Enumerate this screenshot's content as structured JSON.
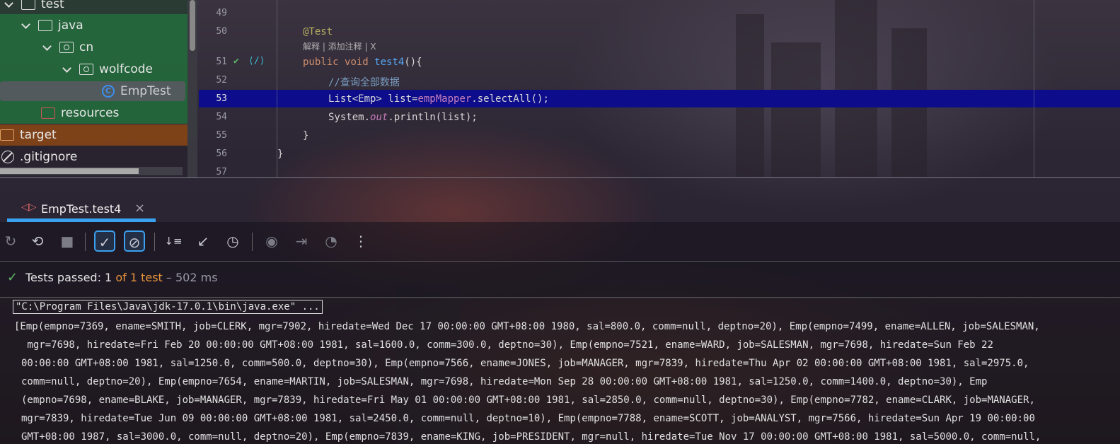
{
  "tree": {
    "items": [
      {
        "label": "test",
        "kind": "folder"
      },
      {
        "label": "java",
        "kind": "folder"
      },
      {
        "label": "cn",
        "kind": "package"
      },
      {
        "label": "wolfcode",
        "kind": "package"
      },
      {
        "label": "EmpTest",
        "kind": "class"
      },
      {
        "label": "resources",
        "kind": "resources-folder"
      },
      {
        "label": "target",
        "kind": "folder"
      },
      {
        "label": ".gitignore",
        "kind": "file"
      }
    ]
  },
  "editor": {
    "line_numbers": [
      "49",
      "50",
      "51",
      "52",
      "53",
      "54",
      "55",
      "56",
      "57"
    ],
    "annotation": "@Test",
    "inlay_hint": "解释 | 添加注释 | X",
    "method_keyword1": "public",
    "method_keyword2": "void",
    "method_name": "test4",
    "method_tail": "(){",
    "comment": "//查询全部数据",
    "stmt1_a": "List<Emp> list=",
    "stmt1_field": "empMapper",
    "stmt1_b": ".selectAll();",
    "stmt2_a": "System.",
    "stmt2_out": "out",
    "stmt2_b": ".println(list);",
    "close_method": "}",
    "close_class": "}",
    "highlight_line": "53"
  },
  "run": {
    "tab_label": "EmpTest.test4",
    "close_glyph": "×",
    "toolbar": {
      "rerun": "↻",
      "rerun_failed": "⟲",
      "stop": "■",
      "show_passed": "✓",
      "show_ignored": "⊘",
      "sort": "↓≡",
      "collapse": "↙",
      "history": "◷",
      "screenshot": "◉",
      "import": "⇥",
      "profile": "◔",
      "more": "⋮"
    },
    "status": {
      "check": "✓",
      "prefix": "Tests passed: ",
      "passed": "1",
      "of_text": "of 1 test",
      "duration": " – 502 ms"
    }
  },
  "console": {
    "command": "\"C:\\Program Files\\Java\\jdk-17.0.1\\bin\\java.exe\" ...",
    "lines": [
      "[Emp(empno=7369, ename=SMITH, job=CLERK, mgr=7902, hiredate=Wed Dec 17 00:00:00 GMT+08:00 1980, sal=800.0, comm=null, deptno=20), Emp(empno=7499, ename=ALLEN, job=SALESMAN,",
      " mgr=7698, hiredate=Fri Feb 20 00:00:00 GMT+08:00 1981, sal=1600.0, comm=300.0, deptno=30), Emp(empno=7521, ename=WARD, job=SALESMAN, mgr=7698, hiredate=Sun Feb 22",
      "00:00:00 GMT+08:00 1981, sal=1250.0, comm=500.0, deptno=30), Emp(empno=7566, ename=JONES, job=MANAGER, mgr=7839, hiredate=Thu Apr 02 00:00:00 GMT+08:00 1981, sal=2975.0,",
      "comm=null, deptno=20), Emp(empno=7654, ename=MARTIN, job=SALESMAN, mgr=7698, hiredate=Mon Sep 28 00:00:00 GMT+08:00 1981, sal=1250.0, comm=1400.0, deptno=30), Emp",
      "(empno=7698, ename=BLAKE, job=MANAGER, mgr=7839, hiredate=Fri May 01 00:00:00 GMT+08:00 1981, sal=2850.0, comm=null, deptno=30), Emp(empno=7782, ename=CLARK, job=MANAGER,",
      "mgr=7839, hiredate=Tue Jun 09 00:00:00 GMT+08:00 1981, sal=2450.0, comm=null, deptno=10), Emp(empno=7788, ename=SCOTT, job=ANALYST, mgr=7566, hiredate=Sun Apr 19 00:00:00",
      "GMT+08:00 1987, sal=3000.0, comm=null, deptno=20), Emp(empno=7839, ename=KING, job=PRESIDENT, mgr=null, hiredate=Tue Nov 17 00:00:00 GMT+08:00 1981, sal=5000.0, comm=null,"
    ]
  },
  "colors": {
    "accent": "#3aa0f0",
    "highlight_line_bg": "#0d0d8c",
    "pass_green": "#5fb865",
    "count_orange": "#e8943a"
  }
}
